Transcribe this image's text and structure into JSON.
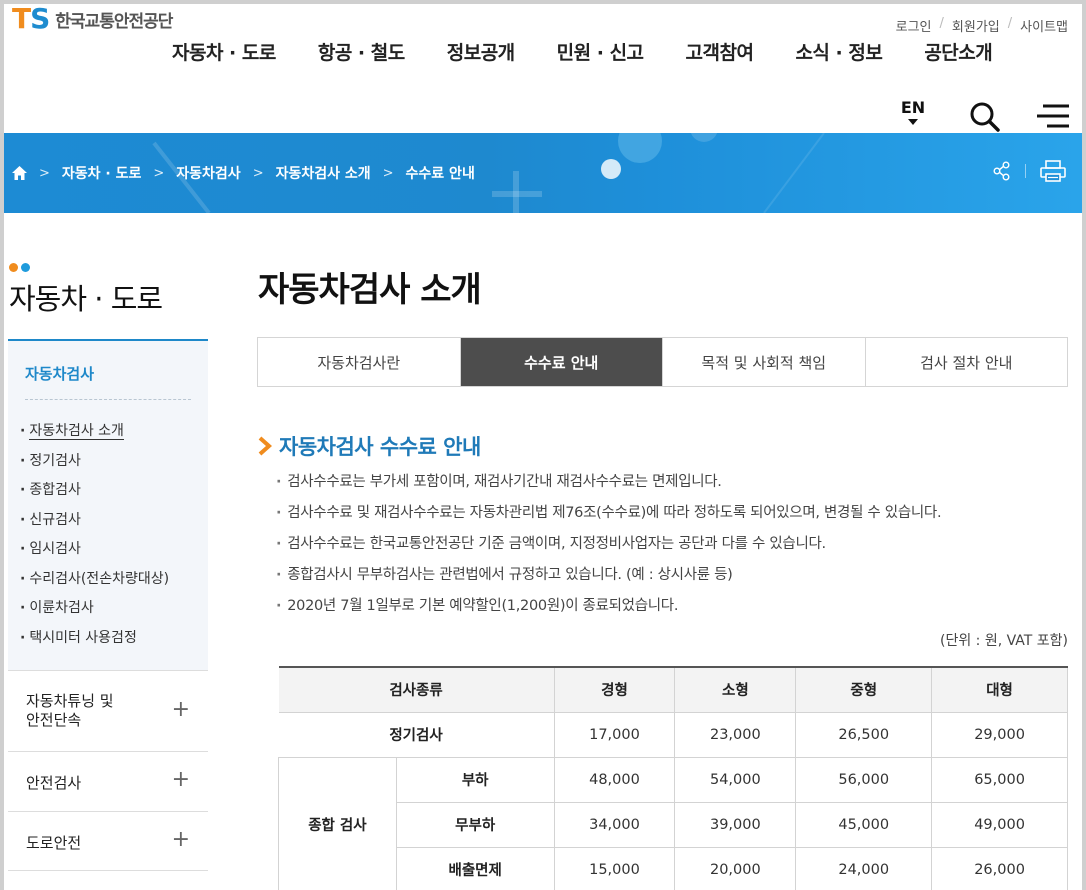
{
  "header": {
    "logo_mark_t": "T",
    "logo_mark_s": "S",
    "logo_text": "한국교통안전공단",
    "util_links": [
      "로그인",
      "회원가입",
      "사이트맵"
    ],
    "gnb": [
      "자동차 · 도로",
      "항공 · 철도",
      "정보공개",
      "민원 · 신고",
      "고객참여",
      "소식 · 정보",
      "공단소개"
    ],
    "lang": "EN",
    "icons": {
      "search": "search-icon",
      "menu": "hamburger-menu-icon"
    }
  },
  "banner": {
    "breadcrumb": [
      "자동차 · 도로",
      "자동차검사",
      "자동차검사 소개",
      "수수료 안내"
    ],
    "icons": {
      "home": "home-icon",
      "share": "share-icon",
      "print": "print-icon"
    }
  },
  "sidebar": {
    "title": "자동차 · 도로",
    "current": "자동차검사",
    "sub_items": [
      "자동차검사 소개",
      "정기검사",
      "종합검사",
      "신규검사",
      "임시검사",
      "수리검사(전손차량대상)",
      "이륜차검사",
      "택시미터 사용검정"
    ],
    "active_sub": "자동차검사 소개",
    "items": [
      {
        "label_line1": "자동차튜닝 및",
        "label_line2": "안전단속"
      },
      {
        "label_line1": "안전검사",
        "label_line2": ""
      },
      {
        "label_line1": "도로안전",
        "label_line2": ""
      }
    ],
    "plus": "+"
  },
  "main": {
    "page_title": "자동차검사 소개",
    "tabs": [
      "자동차검사란",
      "수수료 안내",
      "목적 및 사회적 책임",
      "검사 절차 안내"
    ],
    "active_tab": "수수료 안내",
    "section_title": "자동차검사 수수료 안내",
    "bullets": [
      "검사수수료는 부가세 포함이며, 재검사기간내 재검사수수료는 면제입니다.",
      "검사수수료 및 재검사수수료는 자동차관리법 제76조(수수료)에 따라 정하도록 되어있으며, 변경될 수 있습니다.",
      "검사수수료는 한국교통안전공단 기준 금액이며, 지정정비사업자는 공단과 다를 수 있습니다.",
      "종합검사시 무부하검사는 관련법에서 규정하고 있습니다. (예 : 상시사륜 등)",
      "2020년 7월 1일부로 기본 예약할인(1,200원)이 종료되었습니다."
    ],
    "unit_note": "(단위 : 원, VAT 포함)",
    "table": {
      "headers": [
        "검사종류",
        "경형",
        "소형",
        "중형",
        "대형"
      ],
      "regular": {
        "label": "정기검사",
        "values": [
          "17,000",
          "23,000",
          "26,500",
          "29,000"
        ]
      },
      "combined_label": "종합 검사",
      "combined_rows": [
        {
          "label": "부하",
          "values": [
            "48,000",
            "54,000",
            "56,000",
            "65,000"
          ]
        },
        {
          "label": "무부하",
          "values": [
            "34,000",
            "39,000",
            "45,000",
            "49,000"
          ]
        },
        {
          "label": "배출면제",
          "values": [
            "15,000",
            "20,000",
            "24,000",
            "26,000"
          ]
        }
      ]
    }
  },
  "colors": {
    "accent": "#1e88c9",
    "logo_orange": "#f08c1e",
    "logo_blue": "#1f8ccf",
    "tab_active_bg": "#4d4d4d",
    "banner_blue": "#1e8bd4"
  }
}
